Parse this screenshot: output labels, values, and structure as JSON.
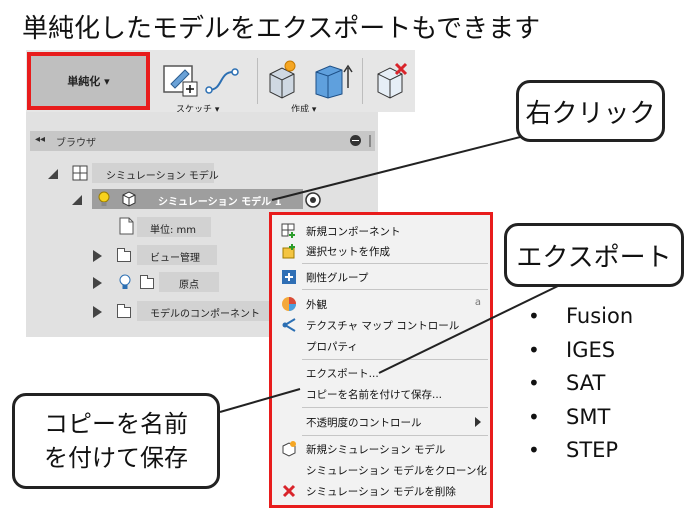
{
  "heading": "単純化したモデルをエクスポートもできます",
  "toolbar": {
    "simplify_label": "単純化 ▾",
    "sketch_label": "スケッチ ▾",
    "create_label": "作成 ▾"
  },
  "browser": {
    "header_arrows": "◂◂",
    "header_label": "ブラウザ",
    "nodes": {
      "root": "シミュレーション モデル",
      "model1": "シミュレーション モデル 1",
      "units": "単位: mm",
      "views": "ビュー管理",
      "origin": "原点",
      "components": "モデルのコンポーネント"
    }
  },
  "context_menu": {
    "items": [
      {
        "label": "新規コンポーネント",
        "icon": "new-component-icon"
      },
      {
        "label": "選択セットを作成",
        "icon": "selection-set-icon"
      },
      {
        "label": "剛性グループ",
        "icon": "rigid-group-icon"
      },
      {
        "label": "外観",
        "icon": "appearance-icon",
        "shortcut": "a"
      },
      {
        "label": "テクスチャ マップ コントロール",
        "icon": "texture-map-icon"
      },
      {
        "label": "プロパティ",
        "icon": ""
      },
      {
        "label": "エクスポート...",
        "icon": ""
      },
      {
        "label": "コピーを名前を付けて保存...",
        "icon": ""
      },
      {
        "label": "不透明度のコントロール",
        "icon": "",
        "submenu": true
      },
      {
        "label": "新規シミュレーション モデル",
        "icon": "new-sim-model-icon"
      },
      {
        "label": "シミュレーション モデルをクローン化",
        "icon": ""
      },
      {
        "label": "シミュレーション モデルを削除",
        "icon": "delete-icon"
      }
    ]
  },
  "callouts": {
    "right_click": "右クリック",
    "export": "エクスポート",
    "save_copy_line1": "コピーを名前",
    "save_copy_line2": "を付けて保存"
  },
  "formats": [
    "Fusion",
    "IGES",
    "SAT",
    "SMT",
    "STEP"
  ],
  "colors": {
    "highlight_border": "#e81c1c",
    "toolbar_bg": "#e6e6e6",
    "panel_bg": "#e1e1e1",
    "menu_bg": "#f2f2f2"
  }
}
